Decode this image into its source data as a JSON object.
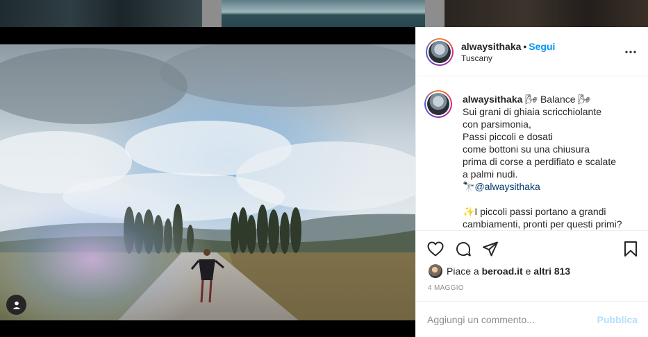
{
  "post": {
    "username": "alwaysithaka",
    "follow_label": "Segui",
    "location": "Tuscany",
    "caption": {
      "username": "alwaysithaka",
      "title": "🌬 Balance 🌬",
      "lines": [
        "Sui grani di ghiaia scricchiolante",
        "con parsimonia,",
        "Passi piccoli e dosati",
        "come bottoni su una chiusura",
        "prima di corse a perdifiato e scalate",
        "a palmi nudi."
      ],
      "credit_prefix": "🔭",
      "credit_mention": "@alwaysithaka",
      "para2_line1": "✨I piccoli passi portano a grandi",
      "para2_line2": "cambiamenti, pronti per questi primi?"
    },
    "likes": {
      "prefix": "Piace a",
      "user": "beroad.it",
      "middle": "e",
      "others": "altri 813"
    },
    "date": "4 MAGGIO",
    "comment": {
      "placeholder": "Aggiungi un commento...",
      "publish_label": "Pubblica"
    }
  },
  "icons": {
    "more": "more-options-icon",
    "like": "heart-icon",
    "comment": "comment-bubble-icon",
    "share": "paper-plane-icon",
    "save": "bookmark-icon",
    "tag": "user-tag-icon"
  },
  "colors": {
    "accent": "#0095f6",
    "publish_disabled": "#b2dffc",
    "text": "#262626",
    "muted": "#8e8e8e",
    "mention": "#00376b"
  }
}
